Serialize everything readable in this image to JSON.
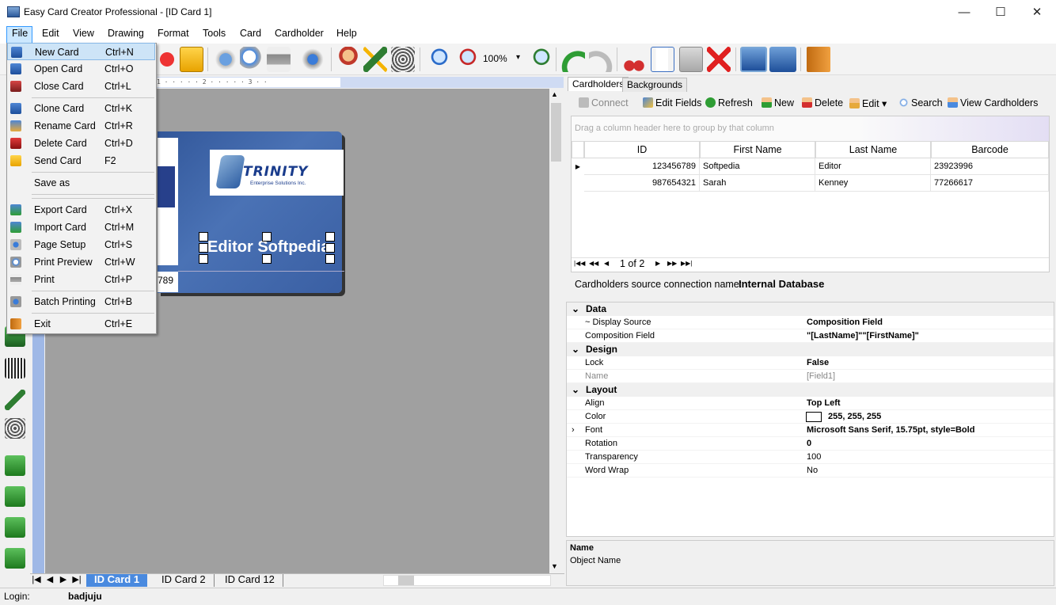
{
  "window": {
    "title": "Easy Card Creator Professional - [ID Card 1]",
    "minimize": "—",
    "maximize": "☐",
    "close": "✕"
  },
  "menu": [
    "File",
    "Edit",
    "View",
    "Drawing",
    "Format",
    "Tools",
    "Card",
    "Cardholder",
    "Help"
  ],
  "toolbar": {
    "zoom": "100%",
    "zoom_arrow": "▾"
  },
  "ruler": {
    "marks": "1 · · · · · 2 · · · · · 3 · ·"
  },
  "card": {
    "logo_name": "TRINITY",
    "logo_subtitle": "Enterprise Solutions Inc.",
    "name_text": "Editor Softpedia",
    "id_fragment": "789"
  },
  "file_menu": [
    {
      "label": "New Card",
      "shortcut": "Ctrl+N",
      "icon": "new-card-icon"
    },
    {
      "label": "Open Card",
      "shortcut": "Ctrl+O",
      "icon": "open-card-icon"
    },
    {
      "label": "Close Card",
      "shortcut": "Ctrl+L",
      "icon": "close-card-icon"
    },
    {
      "label": "Clone Card",
      "shortcut": "Ctrl+K",
      "icon": "clone-card-icon"
    },
    {
      "label": "Rename Card",
      "shortcut": "Ctrl+R",
      "icon": "rename-card-icon"
    },
    {
      "label": "Delete Card",
      "shortcut": "Ctrl+D",
      "icon": "delete-card-icon"
    },
    {
      "label": "Send Card",
      "shortcut": "F2",
      "icon": "send-card-icon"
    },
    {
      "label": "Save as",
      "shortcut": "",
      "icon": ""
    },
    {
      "label": "Export Card",
      "shortcut": "Ctrl+X",
      "icon": "export-card-icon"
    },
    {
      "label": "Import Card",
      "shortcut": "Ctrl+M",
      "icon": "import-card-icon"
    },
    {
      "label": "Page Setup",
      "shortcut": "Ctrl+S",
      "icon": "page-setup-icon"
    },
    {
      "label": "Print Preview",
      "shortcut": "Ctrl+W",
      "icon": "print-preview-icon"
    },
    {
      "label": "Print",
      "shortcut": "Ctrl+P",
      "icon": "print-icon"
    },
    {
      "label": "Batch Printing",
      "shortcut": "Ctrl+B",
      "icon": "batch-printing-icon"
    },
    {
      "label": "Exit",
      "shortcut": "Ctrl+E",
      "icon": "exit-icon"
    }
  ],
  "sheets": {
    "nav": [
      "|◀",
      "◀",
      "▶",
      "▶|"
    ],
    "tabs": [
      "ID Card 1",
      "ID Card 2",
      "ID Card 12"
    ],
    "active": "ID Card 1"
  },
  "status": {
    "label": "Login:",
    "user": "badjuju"
  },
  "right": {
    "tabs": [
      "Cardholders",
      "Backgrounds"
    ],
    "actions": [
      "Connect",
      "Edit Fields",
      "Refresh",
      "New",
      "Delete",
      "Edit ▾",
      "Search",
      "View Cardholders"
    ],
    "group_hint": "Drag a column header here to group by that column",
    "columns": [
      "ID",
      "First Name",
      "Last Name",
      "Barcode"
    ],
    "rows": [
      [
        "123456789",
        "Softpedia",
        "Editor",
        "23923996"
      ],
      [
        "987654321",
        "Sarah",
        "Kenney",
        "77266617"
      ]
    ],
    "pager": "1 of 2",
    "pager_nav": [
      "|◀◀",
      "◀◀",
      "◀",
      "▶",
      "▶▶",
      "▶▶|"
    ],
    "conn_label": "Cardholders source connection name:",
    "conn_value": "Internal Database"
  },
  "properties": {
    "data": {
      "title": "Data",
      "display_source": "~ Display Source",
      "display_source_val": "Composition Field",
      "composition": "Composition Field",
      "composition_val": "\"[LastName]\"\"[FirstName]\""
    },
    "design": {
      "title": "Design",
      "lock": "Lock",
      "lock_val": "False",
      "name": "Name",
      "name_val": "[Field1]"
    },
    "layout": {
      "title": "Layout",
      "align": "Align",
      "align_val": "Top Left",
      "color": "Color",
      "color_val": "255, 255, 255",
      "font": "Font",
      "font_val": "Microsoft Sans Serif, 15.75pt, style=Bold",
      "rotation": "Rotation",
      "rotation_val": "0",
      "transparency": "Transparency",
      "transparency_val": "100",
      "wordwrap": "Word Wrap",
      "wordwrap_val": "No"
    },
    "desc_title": "Name",
    "desc_text": "Object Name"
  }
}
